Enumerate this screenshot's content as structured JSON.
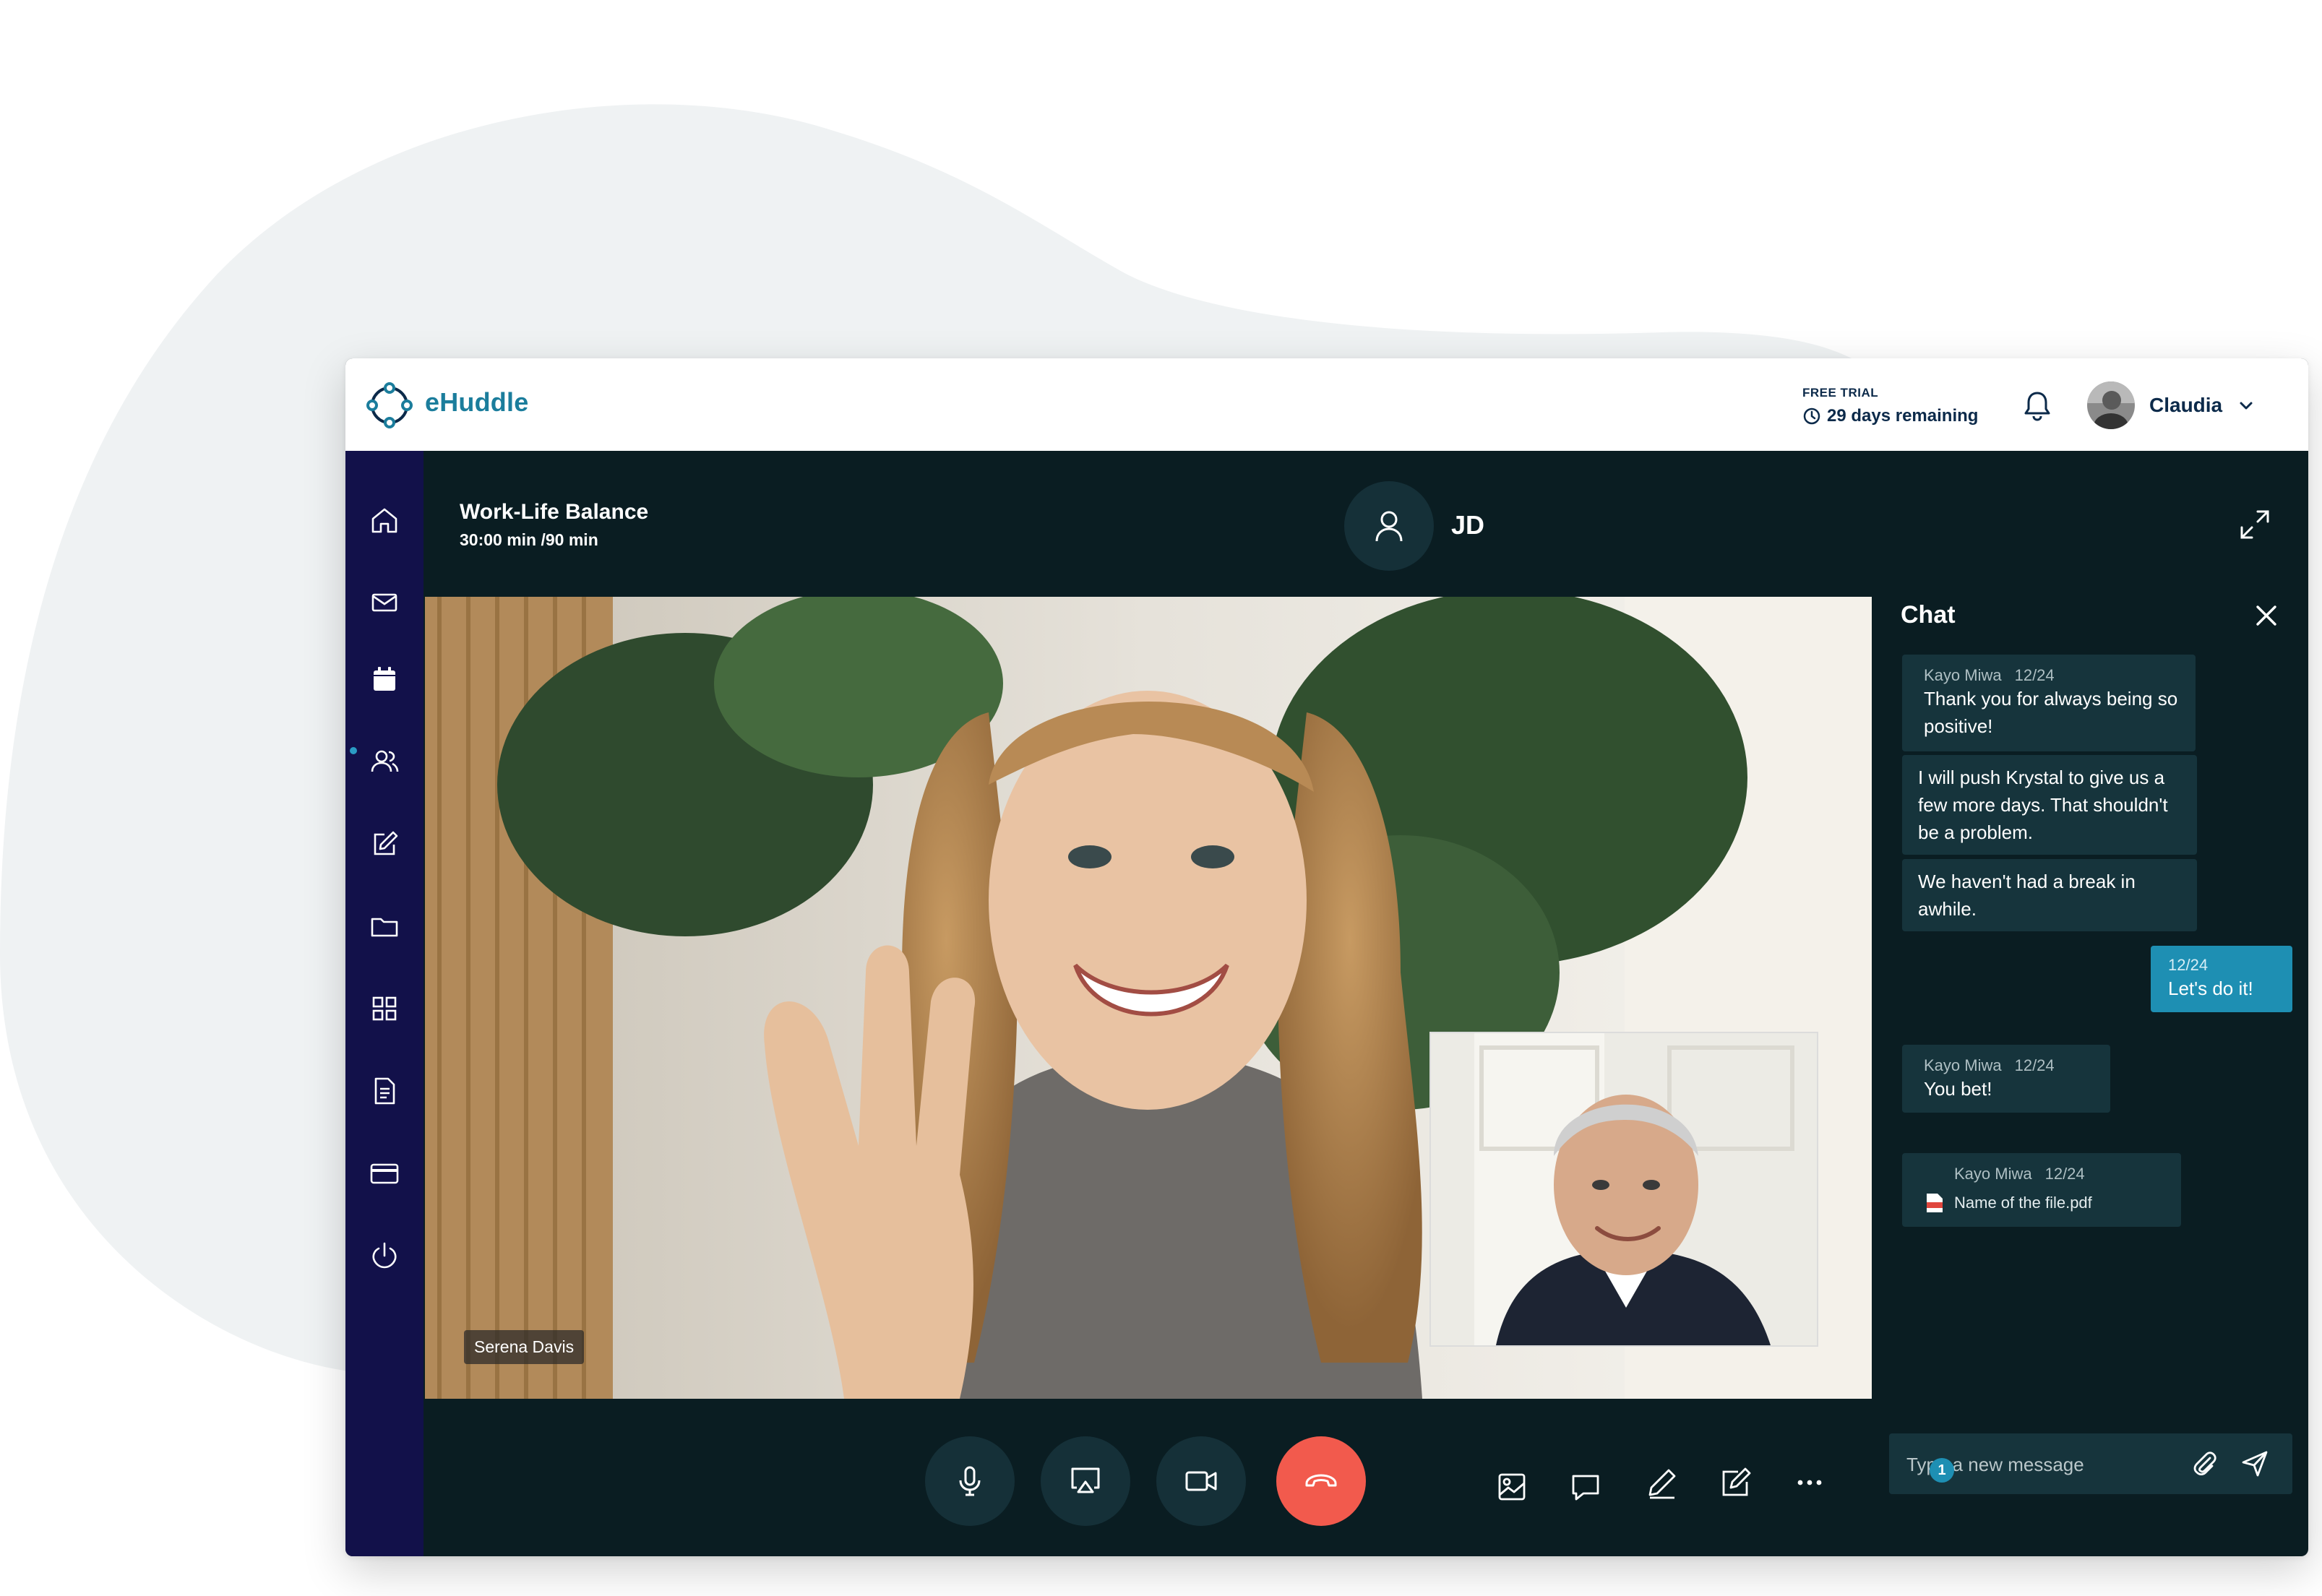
{
  "app": {
    "brand": "eHuddle",
    "trial_label": "FREE TRIAL",
    "trial_remaining": "29 days remaining",
    "user_name": "Claudia"
  },
  "sidebar": {
    "items": [
      {
        "icon": "home-icon"
      },
      {
        "icon": "mail-icon"
      },
      {
        "icon": "calendar-icon",
        "active": true
      },
      {
        "icon": "people-icon"
      },
      {
        "icon": "edit-icon"
      },
      {
        "icon": "folder-icon"
      },
      {
        "icon": "grid-icon"
      },
      {
        "icon": "document-icon"
      },
      {
        "icon": "card-icon"
      },
      {
        "icon": "power-icon"
      }
    ]
  },
  "call": {
    "title": "Work-Life Balance",
    "time": "30:00 min /90 min",
    "participant_initials": "JD",
    "speaker_name": "Serena Davis"
  },
  "chat": {
    "title": "Chat",
    "messages": [
      {
        "author": "Kayo Miwa",
        "date": "12/24",
        "text": "Thank you for always being so positive!"
      },
      {
        "text": "I will push Krystal to give us a few more days. That shouldn't be a problem."
      },
      {
        "text": "We haven't had a break in awhile."
      },
      {
        "date": "12/24",
        "text": "Let's do it!",
        "mine": true
      },
      {
        "author": "Kayo Miwa",
        "date": "12/24",
        "text": "You bet!"
      },
      {
        "author": "Kayo Miwa",
        "date": "12/24",
        "file": "Name of the file.pdf"
      }
    ],
    "input_placeholder": "Type a new message"
  },
  "toolbar": {
    "chat_badge": "1"
  },
  "colors": {
    "accent": "#1e8fb3",
    "end_call": "#f25a4d",
    "sidebar": "#12114a",
    "stage": "#0a1d22"
  }
}
